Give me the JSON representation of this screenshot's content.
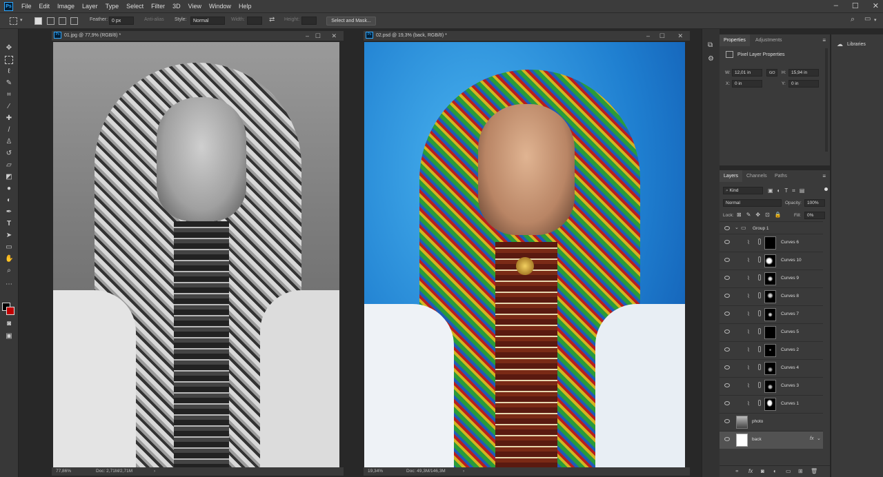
{
  "menubar": {
    "logo": "Ps",
    "items": [
      "File",
      "Edit",
      "Image",
      "Layer",
      "Type",
      "Select",
      "Filter",
      "3D",
      "View",
      "Window",
      "Help"
    ],
    "window_controls": [
      "–",
      "☐",
      "✕"
    ]
  },
  "options": {
    "feather_label": "Feather:",
    "feather_value": "0 px",
    "antialias_label": "Anti-alias",
    "style_label": "Style:",
    "style_value": "Normal",
    "width_label": "Width:",
    "height_label": "Height:",
    "select_mask": "Select and Mask..."
  },
  "doc1": {
    "title": "01.jpg @ 77,9% (RGB/8) *",
    "zoom": "77,86%",
    "doc_info": "Doc: 2,71M/2,71M"
  },
  "doc2": {
    "title": "02.psd @ 19,3% (back, RGB/8) *",
    "zoom": "19,34%",
    "doc_info": "Doc: 49,3M/146,3M"
  },
  "properties": {
    "tabs": [
      "Properties",
      "Adjustments"
    ],
    "heading": "Pixel Layer Properties",
    "w_label": "W:",
    "w_value": "12,01 in",
    "h_label": "H:",
    "h_value": "15,94 in",
    "x_label": "X:",
    "x_value": "0 in",
    "y_label": "Y:",
    "y_value": "0 in",
    "link_label": "GO"
  },
  "layers": {
    "tabs": [
      "Layers",
      "Channels",
      "Paths"
    ],
    "kind_label": "Kind",
    "blend_mode": "Normal",
    "opacity_label": "Opacity:",
    "opacity_value": "100%",
    "lock_label": "Lock:",
    "fill_label": "Fill:",
    "fill_value": "0%",
    "group_name": "Group 1",
    "curves": [
      "Curves 6",
      "Curves 10",
      "Curves 9",
      "Curves 8",
      "Curves 7",
      "Curves 5",
      "Curves 2",
      "Curves 4",
      "Curves 3",
      "Curves 1"
    ],
    "photo_layer": "photo",
    "back_layer": "back",
    "fx_label": "fx"
  },
  "libraries": {
    "label": "Libraries"
  },
  "colors": {
    "background": "#282828",
    "panel": "#3a3a3a",
    "accent": "#31a8ff",
    "photo_bg_blue": "#1f7fd0"
  }
}
